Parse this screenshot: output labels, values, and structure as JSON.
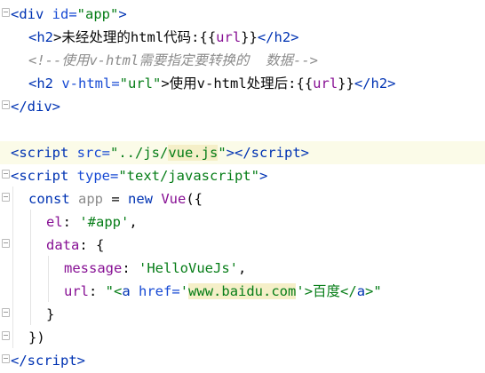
{
  "code_lines": [
    {
      "t1": "<div",
      "a1": " id=",
      "s1": "\"app\"",
      "t2": ">"
    },
    {
      "t1": "<h2",
      "txt": ">未经处理的html代码:{{",
      "var": "url",
      "txt2": "}}",
      "t2": "</h2",
      "t3": ">"
    },
    {
      "comment": "<!--使用v-html需要指定要转换的  数据-->"
    },
    {
      "t1": "<h2",
      "a1": " v-html=",
      "s1": "\"url\"",
      "txt": ">使用v-html处理后:{{",
      "var": "url",
      "txt2": "}}",
      "t2": "</h2",
      "t3": ">"
    },
    {
      "t1": "</div",
      "t2": ">"
    },
    {},
    {
      "t1": "<script",
      "a1": " src=",
      "s1": "\"../js/",
      "s2": "vue.js",
      "s3": "\"",
      "t2": "></script",
      "t3": ">"
    },
    {
      "t1": "<script",
      "a1": " type=",
      "s1": "\"text/javascript\"",
      "t2": ">"
    },
    {
      "k1": "const",
      "d1": " app",
      "p1": " = ",
      "k2": "new",
      "m1": " Vue",
      "p2": "({"
    },
    {
      "v1": "el",
      "p1": ": ",
      "s1": "'#app'",
      "p2": ","
    },
    {
      "v1": "data",
      "p1": ": {"
    },
    {
      "v1": "message",
      "p1": ": ",
      "s1": "'HelloVueJs'",
      "p2": ","
    },
    {
      "v1": "url",
      "p1": ": ",
      "s1": "\"<",
      "t1": "a",
      "a1": " href=",
      "s2": "'",
      "s3": "www.baidu.com",
      "s4": "'",
      "s5": ">百度</",
      "t2": "a",
      "s6": ">\""
    },
    {
      "p1": "}"
    },
    {
      "p1": "})"
    },
    {
      "t1": "</script",
      "t2": ">"
    }
  ]
}
